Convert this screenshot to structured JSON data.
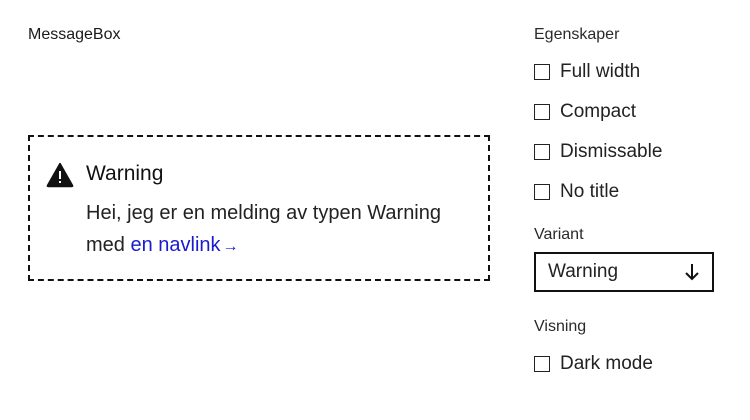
{
  "preview": {
    "component_name": "MessageBox",
    "messagebox": {
      "icon": "warning-triangle-icon",
      "title": "Warning",
      "body_text": "Hei, jeg er en melding av typen Warning med",
      "link_text": "en navlink",
      "link_arrow": "→"
    }
  },
  "panel": {
    "properties": {
      "title": "Egenskaper",
      "options": [
        {
          "label": "Full width",
          "checked": false
        },
        {
          "label": "Compact",
          "checked": false
        },
        {
          "label": "Dismissable",
          "checked": false
        },
        {
          "label": "No title",
          "checked": false
        }
      ]
    },
    "variant": {
      "title": "Variant",
      "selected": "Warning",
      "icon": "arrow-down-icon"
    },
    "display": {
      "title": "Visning",
      "options": [
        {
          "label": "Dark mode",
          "checked": false
        }
      ]
    }
  },
  "colors": {
    "link": "#1a1ad1",
    "border": "#111111"
  }
}
